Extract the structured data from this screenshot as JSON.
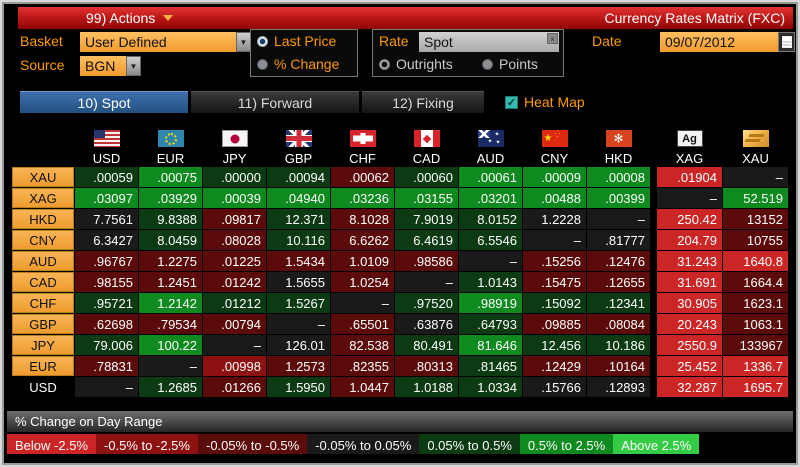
{
  "titlebar": {
    "actions": "99) Actions",
    "title": "Currency Rates Matrix (FXC)"
  },
  "controls": {
    "basket_label": "Basket",
    "basket_value": "User Defined",
    "source_label": "Source",
    "source_value": "BGN",
    "price_modes": [
      {
        "label": "Last Price",
        "selected": true
      },
      {
        "label": "% Change",
        "selected": false
      }
    ],
    "rate_label": "Rate",
    "rate_value": "Spot",
    "rate_modes": [
      {
        "label": "Outrights",
        "selected": true
      },
      {
        "label": "Points",
        "selected": false
      }
    ],
    "date_label": "Date",
    "date_value": "09/07/2012"
  },
  "tabs": [
    {
      "label": "10) Spot",
      "active": true
    },
    {
      "label": "11) Forward",
      "active": false
    },
    {
      "label": "12) Fixing",
      "active": false
    }
  ],
  "heat_map": {
    "label": "Heat Map",
    "checked": true,
    "check_glyph": "✓"
  },
  "palette": {
    "n": "#1a1a1a",
    "g1": "#0c3a12",
    "g2": "#0e8a1e",
    "g3": "#33cc44",
    "r1": "#5c0b0b",
    "r2": "#8e1111",
    "r3": "#cc2525"
  },
  "matrix": {
    "columns": [
      {
        "code": "USD",
        "flag": "us"
      },
      {
        "code": "EUR",
        "flag": "eu"
      },
      {
        "code": "JPY",
        "flag": "jp"
      },
      {
        "code": "GBP",
        "flag": "uk"
      },
      {
        "code": "CHF",
        "flag": "ch"
      },
      {
        "code": "CAD",
        "flag": "ca"
      },
      {
        "code": "AUD",
        "flag": "au"
      },
      {
        "code": "CNY",
        "flag": "cn"
      },
      {
        "code": "HKD",
        "flag": "hk"
      },
      {
        "code": "XAG",
        "flag": "silver",
        "glyph": "Ag"
      },
      {
        "code": "XAU",
        "flag": "gold"
      }
    ],
    "rows": [
      {
        "label": "XAU",
        "cells": [
          {
            "v": ".00059",
            "c": "g1"
          },
          {
            "v": ".00075",
            "c": "g2"
          },
          {
            "v": ".00000",
            "c": "g1"
          },
          {
            "v": ".00094",
            "c": "g1"
          },
          {
            "v": ".00062",
            "c": "r1"
          },
          {
            "v": ".00060",
            "c": "g1"
          },
          {
            "v": ".00061",
            "c": "g2"
          },
          {
            "v": ".00009",
            "c": "g2"
          },
          {
            "v": ".00008",
            "c": "g2"
          },
          {
            "v": ".01904",
            "c": "r3"
          },
          {
            "v": "–",
            "c": "n"
          }
        ]
      },
      {
        "label": "XAG",
        "cells": [
          {
            "v": ".03097",
            "c": "g2"
          },
          {
            "v": ".03929",
            "c": "g2"
          },
          {
            "v": ".00039",
            "c": "g2"
          },
          {
            "v": ".04940",
            "c": "g2"
          },
          {
            "v": ".03236",
            "c": "g2"
          },
          {
            "v": ".03155",
            "c": "g2"
          },
          {
            "v": ".03201",
            "c": "g2"
          },
          {
            "v": ".00488",
            "c": "g2"
          },
          {
            "v": ".00399",
            "c": "g2"
          },
          {
            "v": "–",
            "c": "n"
          },
          {
            "v": "52.519",
            "c": "g2"
          }
        ]
      },
      {
        "label": "HKD",
        "cells": [
          {
            "v": "7.7561",
            "c": "n"
          },
          {
            "v": "9.8388",
            "c": "g1"
          },
          {
            "v": ".09817",
            "c": "r1"
          },
          {
            "v": "12.371",
            "c": "g1"
          },
          {
            "v": "8.1028",
            "c": "r1"
          },
          {
            "v": "7.9019",
            "c": "g1"
          },
          {
            "v": "8.0152",
            "c": "g1"
          },
          {
            "v": "1.2228",
            "c": "n"
          },
          {
            "v": "–",
            "c": "n"
          },
          {
            "v": "250.42",
            "c": "r3"
          },
          {
            "v": "13152",
            "c": "r1"
          }
        ]
      },
      {
        "label": "CNY",
        "cells": [
          {
            "v": "6.3427",
            "c": "n"
          },
          {
            "v": "8.0459",
            "c": "g1"
          },
          {
            "v": ".08028",
            "c": "r1"
          },
          {
            "v": "10.116",
            "c": "g1"
          },
          {
            "v": "6.6262",
            "c": "r1"
          },
          {
            "v": "6.4619",
            "c": "g1"
          },
          {
            "v": "6.5546",
            "c": "g1"
          },
          {
            "v": "–",
            "c": "n"
          },
          {
            "v": ".81777",
            "c": "n"
          },
          {
            "v": "204.79",
            "c": "r3"
          },
          {
            "v": "10755",
            "c": "r1"
          }
        ]
      },
      {
        "label": "AUD",
        "cells": [
          {
            "v": ".96767",
            "c": "r1"
          },
          {
            "v": "1.2275",
            "c": "r1"
          },
          {
            "v": ".01225",
            "c": "r1"
          },
          {
            "v": "1.5434",
            "c": "r1"
          },
          {
            "v": "1.0109",
            "c": "r1"
          },
          {
            "v": ".98586",
            "c": "r1"
          },
          {
            "v": "–",
            "c": "n"
          },
          {
            "v": ".15256",
            "c": "r1"
          },
          {
            "v": ".12476",
            "c": "r1"
          },
          {
            "v": "31.243",
            "c": "r3"
          },
          {
            "v": "1640.8",
            "c": "r3"
          }
        ]
      },
      {
        "label": "CAD",
        "cells": [
          {
            "v": ".98155",
            "c": "r1"
          },
          {
            "v": "1.2451",
            "c": "r1"
          },
          {
            "v": ".01242",
            "c": "r1"
          },
          {
            "v": "1.5655",
            "c": "n"
          },
          {
            "v": "1.0254",
            "c": "r1"
          },
          {
            "v": "–",
            "c": "n"
          },
          {
            "v": "1.0143",
            "c": "g1"
          },
          {
            "v": ".15475",
            "c": "r1"
          },
          {
            "v": ".12655",
            "c": "r1"
          },
          {
            "v": "31.691",
            "c": "r3"
          },
          {
            "v": "1664.4",
            "c": "r1"
          }
        ]
      },
      {
        "label": "CHF",
        "cells": [
          {
            "v": ".95721",
            "c": "g1"
          },
          {
            "v": "1.2142",
            "c": "g2"
          },
          {
            "v": ".01212",
            "c": "g1"
          },
          {
            "v": "1.5267",
            "c": "g1"
          },
          {
            "v": "–",
            "c": "n"
          },
          {
            "v": ".97520",
            "c": "g1"
          },
          {
            "v": ".98919",
            "c": "g2"
          },
          {
            "v": ".15092",
            "c": "g1"
          },
          {
            "v": ".12341",
            "c": "g1"
          },
          {
            "v": "30.905",
            "c": "r3"
          },
          {
            "v": "1623.1",
            "c": "r1"
          }
        ]
      },
      {
        "label": "GBP",
        "cells": [
          {
            "v": ".62698",
            "c": "r1"
          },
          {
            "v": ".79534",
            "c": "r1"
          },
          {
            "v": ".00794",
            "c": "r1"
          },
          {
            "v": "–",
            "c": "n"
          },
          {
            "v": ".65501",
            "c": "r1"
          },
          {
            "v": ".63876",
            "c": "n"
          },
          {
            "v": ".64793",
            "c": "g1"
          },
          {
            "v": ".09885",
            "c": "r1"
          },
          {
            "v": ".08084",
            "c": "r1"
          },
          {
            "v": "20.243",
            "c": "r3"
          },
          {
            "v": "1063.1",
            "c": "r1"
          }
        ]
      },
      {
        "label": "JPY",
        "cells": [
          {
            "v": "79.006",
            "c": "g1"
          },
          {
            "v": "100.22",
            "c": "g2"
          },
          {
            "v": "–",
            "c": "n"
          },
          {
            "v": "126.01",
            "c": "n"
          },
          {
            "v": "82.538",
            "c": "r1"
          },
          {
            "v": "80.491",
            "c": "g1"
          },
          {
            "v": "81.646",
            "c": "g2"
          },
          {
            "v": "12.456",
            "c": "g1"
          },
          {
            "v": "10.186",
            "c": "g1"
          },
          {
            "v": "2550.9",
            "c": "r3"
          },
          {
            "v": "133967",
            "c": "r1"
          }
        ]
      },
      {
        "label": "EUR",
        "cells": [
          {
            "v": ".78831",
            "c": "r1"
          },
          {
            "v": "–",
            "c": "n"
          },
          {
            "v": ".00998",
            "c": "r2"
          },
          {
            "v": "1.2573",
            "c": "r1"
          },
          {
            "v": ".82355",
            "c": "r1"
          },
          {
            "v": ".80313",
            "c": "r1"
          },
          {
            "v": ".81465",
            "c": "g1"
          },
          {
            "v": ".12429",
            "c": "r1"
          },
          {
            "v": ".10164",
            "c": "r1"
          },
          {
            "v": "25.452",
            "c": "r3"
          },
          {
            "v": "1336.7",
            "c": "r3"
          }
        ]
      },
      {
        "label": "USD",
        "plain": true,
        "cells": [
          {
            "v": "–",
            "c": "n"
          },
          {
            "v": "1.2685",
            "c": "g1"
          },
          {
            "v": ".01266",
            "c": "r1"
          },
          {
            "v": "1.5950",
            "c": "g1"
          },
          {
            "v": "1.0447",
            "c": "r1"
          },
          {
            "v": "1.0188",
            "c": "g1"
          },
          {
            "v": "1.0334",
            "c": "g1"
          },
          {
            "v": ".15766",
            "c": "n"
          },
          {
            "v": ".12893",
            "c": "n"
          },
          {
            "v": "32.287",
            "c": "r3"
          },
          {
            "v": "1695.7",
            "c": "r3"
          }
        ]
      }
    ]
  },
  "legend": {
    "title": "% Change on Day Range",
    "ranges": [
      {
        "label": "Below -2.5%",
        "c": "r3"
      },
      {
        "label": "-0.5% to -2.5%",
        "c": "r2"
      },
      {
        "label": "-0.05% to -0.5%",
        "c": "r1"
      },
      {
        "label": "-0.05% to 0.05%",
        "c": "n"
      },
      {
        "label": "0.05% to 0.5%",
        "c": "g1"
      },
      {
        "label": "0.5% to 2.5%",
        "c": "g2"
      },
      {
        "label": "Above 2.5%",
        "c": "g3"
      }
    ]
  }
}
